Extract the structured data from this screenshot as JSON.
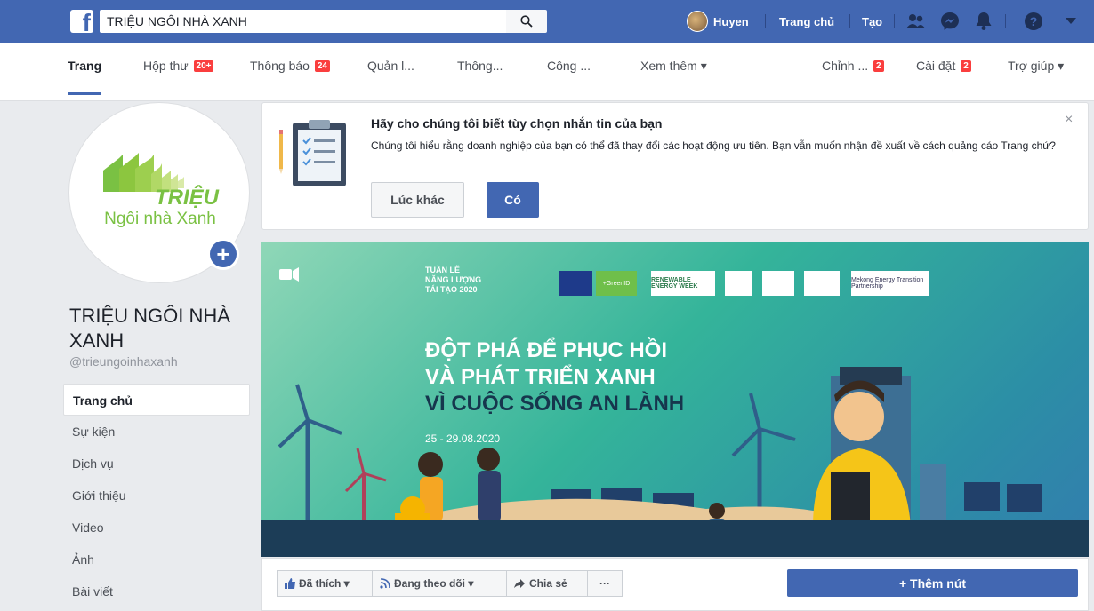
{
  "topbar": {
    "search_value": "TRIỆU NGÔI NHÀ XANH",
    "user_name": "Huyen",
    "home_label": "Trang chủ",
    "create_label": "Tạo"
  },
  "subnav": {
    "items": [
      {
        "label": "Trang",
        "badge": ""
      },
      {
        "label": "Hộp thư",
        "badge": "20+"
      },
      {
        "label": "Thông báo",
        "badge": "24"
      },
      {
        "label": "Quản l...",
        "badge": ""
      },
      {
        "label": "Thông...",
        "badge": ""
      },
      {
        "label": "Công ...",
        "badge": ""
      },
      {
        "label": "Xem thêm ▾",
        "badge": ""
      },
      {
        "label": "Chỉnh ...",
        "badge": "2"
      },
      {
        "label": "Cài đặt",
        "badge": "2"
      },
      {
        "label": "Trợ giúp ▾",
        "badge": ""
      }
    ]
  },
  "page": {
    "logo_line1": "TRIỆU",
    "logo_line2": "Ngôi nhà Xanh",
    "name": "TRIỆU NGÔI NHÀ XANH",
    "handle": "@trieungoinhaxanh"
  },
  "menu": [
    "Trang chủ",
    "Sự kiện",
    "Dịch vụ",
    "Giới thiệu",
    "Video",
    "Ảnh",
    "Bài viết"
  ],
  "prompt": {
    "title": "Hãy cho chúng tôi biết tùy chọn nhắn tin của bạn",
    "body": "Chúng tôi hiểu rằng doanh nghiệp của bạn có thể đã thay đổi các hoạt động ưu tiên. Bạn vẫn muốn nhận đề xuất về cách quảng cáo Trang chứ?",
    "later": "Lúc khác",
    "yes": "Có",
    "close": "×"
  },
  "cover": {
    "event_tag_1": "TUẦN LỄ",
    "event_tag_2": "NĂNG LƯỢNG",
    "event_tag_3": "TÁI TẠO 2020",
    "headline_1": "ĐỘT PHÁ ĐỂ PHỤC HỒI",
    "headline_2": "VÀ PHÁT TRIỂN XANH",
    "headline_3": "VÌ CUỘC SỐNG AN LÀNH",
    "dates": "25 - 29.08.2020",
    "partner_1": "+GreenID",
    "partner_2": "RENEWABLE ENERGY WEEK",
    "partner_3": "Mekong Energy Transition Partnership"
  },
  "actions": {
    "liked": "Đã thích ▾",
    "following": "Đang theo dõi ▾",
    "share": "Chia sẻ",
    "more": "···",
    "add_button": "+ Thêm nút"
  },
  "colors": {
    "brand": "#4267b2",
    "badge": "#fa3e3e",
    "logo_green": "#7ac143"
  }
}
